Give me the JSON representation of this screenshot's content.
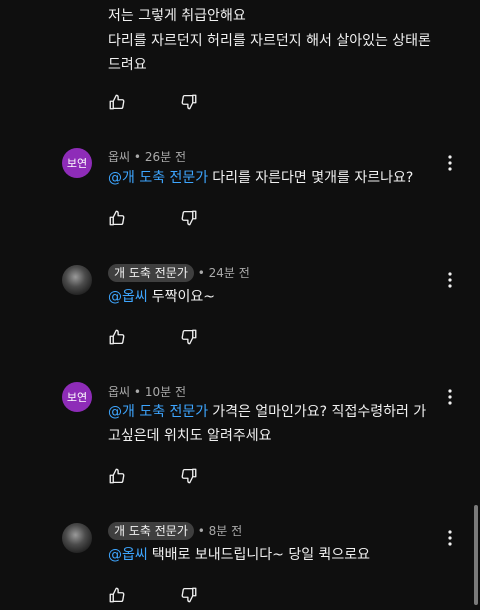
{
  "top_comment": {
    "lines": [
      "저는 그렇게 취급안해요",
      "다리를 자르던지 허리를 자르던지 해서 살아있는 상태론",
      "드려요"
    ]
  },
  "comments": [
    {
      "avatar_letter": "보연",
      "author": "옵씨",
      "time": "26분 전",
      "mention": "@개 도축 전문가",
      "lines": [
        "다리를 자른다면 몇개를 자르나요?"
      ]
    },
    {
      "author": "개 도축 전문가",
      "time": "24분 전",
      "mention": "@옵씨",
      "lines": [
        "두짝이요~"
      ]
    },
    {
      "avatar_letter": "보연",
      "author": "옵씨",
      "time": "10분 전",
      "mention": "@개 도축 전문가",
      "lines": [
        "가격은 얼마인가요? 직접수령하러 가",
        "고싶은데 위치도 알려주세요"
      ]
    },
    {
      "author": "개 도축 전문가",
      "time": "8분 전",
      "mention": "@옵씨",
      "lines": [
        "택배로 보내드립니다~ 당일 퀵으로요"
      ]
    }
  ],
  "separator": "•",
  "colors": {
    "background": "#0f0f0f",
    "mention": "#3ea6ff",
    "avatar_purple": "#8e2cb8",
    "chip": "#3f3f3f"
  },
  "icons": [
    "thumbs-up-icon",
    "thumbs-down-icon",
    "more-vert-icon"
  ]
}
